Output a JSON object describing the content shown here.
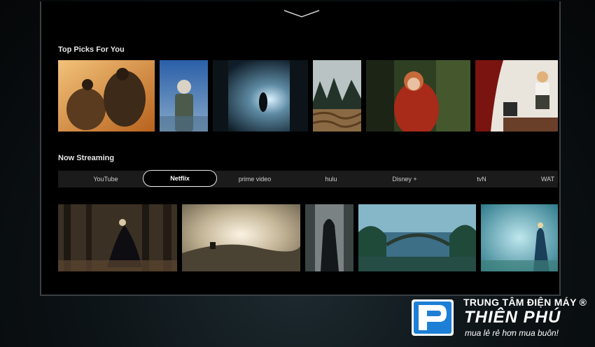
{
  "sections": {
    "top_picks_title": "Top Picks For You",
    "now_streaming_title": "Now Streaming"
  },
  "streaming_tabs": [
    {
      "label": "YouTube"
    },
    {
      "label": "Netflix",
      "selected": true
    },
    {
      "label": "prime video"
    },
    {
      "label": "hulu"
    },
    {
      "label": "Disney +"
    },
    {
      "label": "tvN"
    },
    {
      "label": "WAT"
    }
  ],
  "icons": {
    "top_handle": "chevron-down-icon",
    "brand_logo": "thien-phu-logo-icon"
  },
  "watermark": {
    "line1": "TRUNG TÂM ĐIỆN MÁY ®",
    "line2": "THIÊN PHÚ",
    "line3": "mua lẻ rẻ hơn mua buôn!"
  },
  "colors": {
    "screen_bg": "#000000",
    "active_tab_border": "#e8e8e8",
    "brand_blue": "#1e7fd6"
  }
}
